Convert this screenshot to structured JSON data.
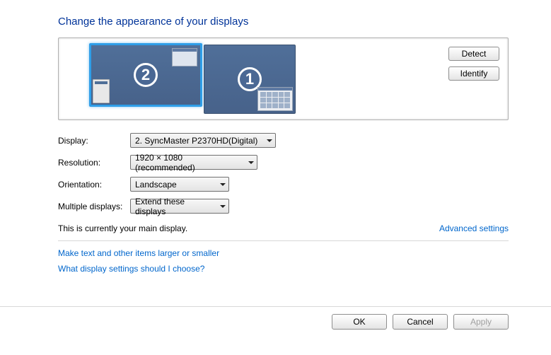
{
  "title": "Change the appearance of your displays",
  "preview": {
    "monitors": [
      {
        "id": 2,
        "primary": true,
        "selected": true
      },
      {
        "id": 1,
        "primary": false,
        "selected": false
      }
    ],
    "detect_label": "Detect",
    "identify_label": "Identify"
  },
  "fields": {
    "display": {
      "label": "Display:",
      "value": "2. SyncMaster P2370HD(Digital)"
    },
    "resolution": {
      "label": "Resolution:",
      "value": "1920 × 1080 (recommended)"
    },
    "orientation": {
      "label": "Orientation:",
      "value": "Landscape"
    },
    "multiple": {
      "label": "Multiple displays:",
      "value": "Extend these displays"
    }
  },
  "main_display_note": "This is currently your main display.",
  "advanced_link": "Advanced settings",
  "links": {
    "dpi": "Make text and other items larger or smaller",
    "help": "What display settings should I choose?"
  },
  "buttons": {
    "ok": "OK",
    "cancel": "Cancel",
    "apply": "Apply"
  }
}
